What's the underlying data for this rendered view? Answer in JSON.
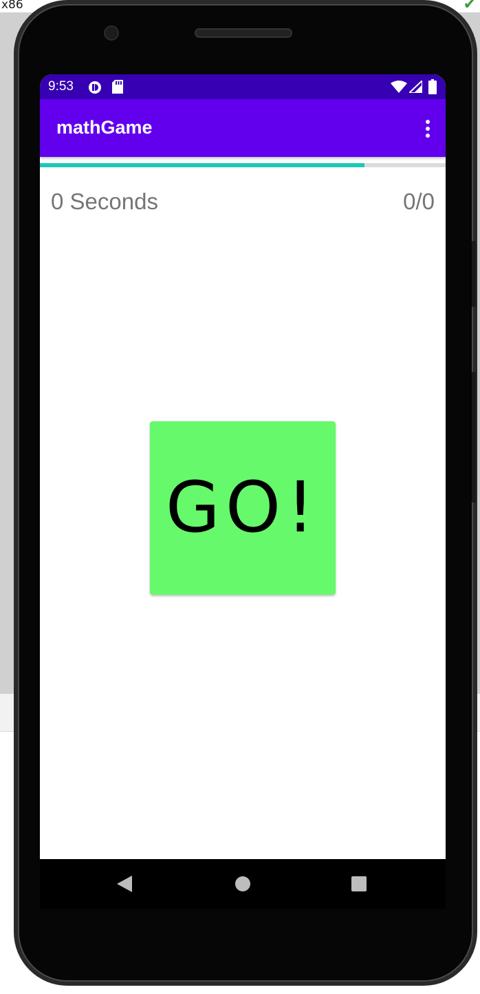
{
  "host": {
    "label": "x86",
    "check_icon": "checkmark-icon"
  },
  "status_bar": {
    "time": "9:53",
    "icons": [
      "app-notification-icon",
      "sd-card-icon",
      "wifi-icon",
      "cell-signal-icon",
      "battery-icon"
    ]
  },
  "app_bar": {
    "title": "mathGame",
    "overflow_icon": "more-vert-icon"
  },
  "progress": {
    "value_percent": 80
  },
  "game": {
    "timer_text": "0 Seconds",
    "score_text": "0/0",
    "go_label": "GO!"
  },
  "nav_bar": {
    "icons": [
      "back-icon",
      "home-icon",
      "recents-icon"
    ]
  },
  "colors": {
    "status_bar": "#3700b3",
    "app_bar": "#6200ee",
    "progress_fill": "#1ec8b8",
    "progress_track": "#dcdcdc",
    "go_button": "#66f96b",
    "secondary_text": "#757575"
  }
}
